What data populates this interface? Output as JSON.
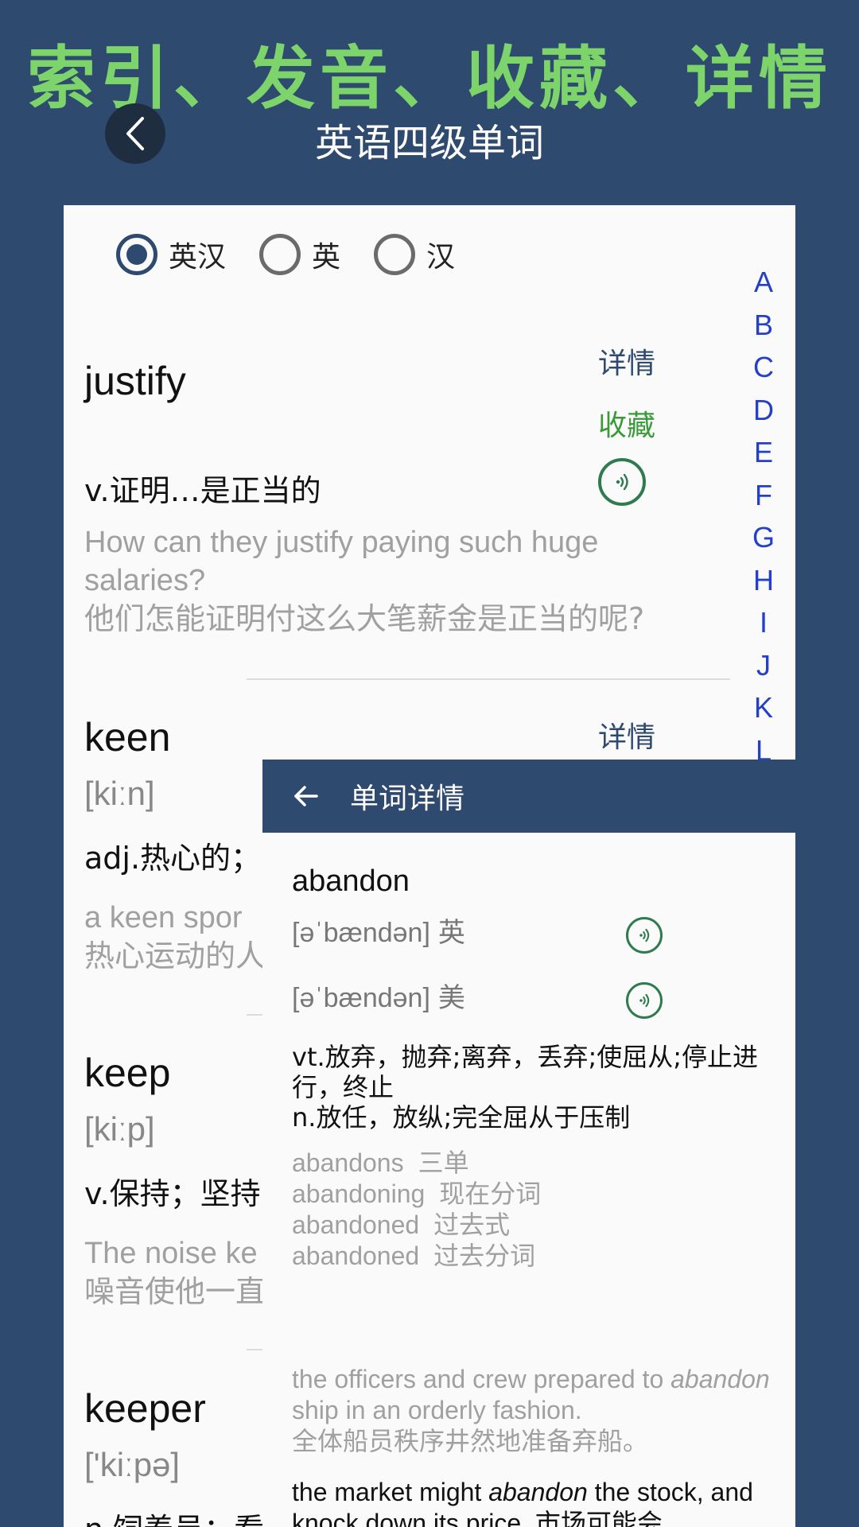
{
  "promo_title": "索引、发音、收藏、详情",
  "header": {
    "title": "英语四级单词"
  },
  "radio_options": [
    {
      "label": "英汉",
      "checked": true
    },
    {
      "label": "英",
      "checked": false
    },
    {
      "label": "汉",
      "checked": false
    }
  ],
  "alpha_index": [
    "A",
    "B",
    "C",
    "D",
    "E",
    "F",
    "G",
    "H",
    "I",
    "J",
    "K",
    "L"
  ],
  "entries": [
    {
      "word": "justify",
      "phonetic": "",
      "definition": "v.证明…是正当的",
      "example_en": "How can they justify paying such huge salaries?",
      "example_zh": "他们怎能证明付这么大笔薪金是正当的呢?",
      "detail_label": "详情",
      "favorite_label": "收藏"
    },
    {
      "word": "keen",
      "phonetic": "[kiːn]",
      "definition": "adj.热心的；",
      "example_en": "a keen spor",
      "example_zh": "热心运动的人",
      "detail_label": "详情"
    },
    {
      "word": "keep",
      "phonetic": "[kiːp]",
      "definition": "v.保持；坚持",
      "example_en": "The noise ke",
      "example_zh": "噪音使他一直"
    },
    {
      "word": "keeper",
      "phonetic": "['kiːpə]",
      "definition": "n.饲养员；看"
    }
  ],
  "detail": {
    "title": "单词详情",
    "word": "abandon",
    "phonetic_uk": "[əˈbændən]",
    "tag_uk": "英",
    "phonetic_us": "[əˈbændən]",
    "tag_us": "美",
    "definition_line1": "vt.放弃，抛弃;离弃，丢弃;使屈从;停止进行，终止",
    "definition_line2": "n.放任，放纵;完全屈从于压制",
    "forms": [
      {
        "form": "abandons",
        "label": "三单"
      },
      {
        "form": "abandoning",
        "label": "现在分词"
      },
      {
        "form": "abandoned",
        "label": "过去式"
      },
      {
        "form": "abandoned",
        "label": "过去分词"
      }
    ],
    "example1_pre": "the officers and crew prepared to ",
    "example1_em": "abandon",
    "example1_post": " ship in an orderly fashion.",
    "example1_zh": "全体船员秩序井然地准备弃船。",
    "example2_pre": "the market might ",
    "example2_em": "abandon",
    "example2_post": " the stock, and knock down its price. 市场可能会"
  },
  "colors": {
    "background": "#2f4a6f",
    "promo_green": "#7dd46a",
    "favorite_green": "#3a9a3a",
    "index_blue": "#2440c8",
    "speaker_green": "#2f7a4f"
  }
}
